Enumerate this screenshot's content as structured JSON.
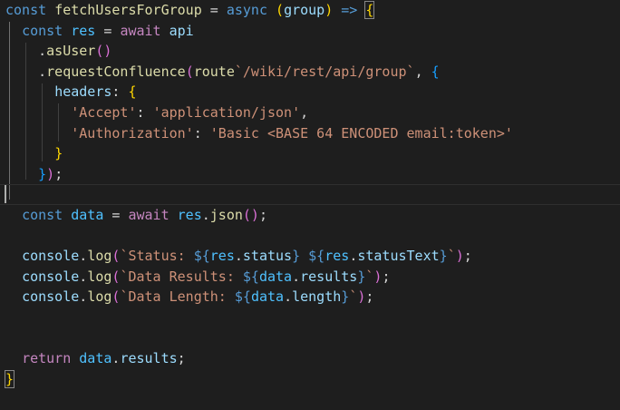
{
  "editor": {
    "lines": [
      "const fetchUsersForGroup = async (group) => {",
      "  const res = await api",
      "    .asUser()",
      "    .requestConfluence(route`/wiki/rest/api/group`, {",
      "      headers: {",
      "        'Accept': 'application/json',",
      "        'Authorization': 'Basic <BASE 64 ENCODED email:token>'",
      "      }",
      "    });",
      "",
      "  const data = await res.json();",
      "",
      "  console.log(`Status: ${res.status} ${res.statusText}`);",
      "  console.log(`Data Results: ${data.results}`);",
      "  console.log(`Data Length: ${data.length}`);",
      "",
      "",
      "  return data.results;",
      "}"
    ]
  },
  "theme": {
    "background": "#1e1e1e",
    "keyword": "#569cd6",
    "control": "#c586c0",
    "function": "#dcdcaa",
    "variable": "#9cdcfe",
    "string": "#ce9178",
    "bracket_level1": "#ffd700",
    "bracket_level2": "#da70d6",
    "bracket_level3": "#179fff"
  }
}
